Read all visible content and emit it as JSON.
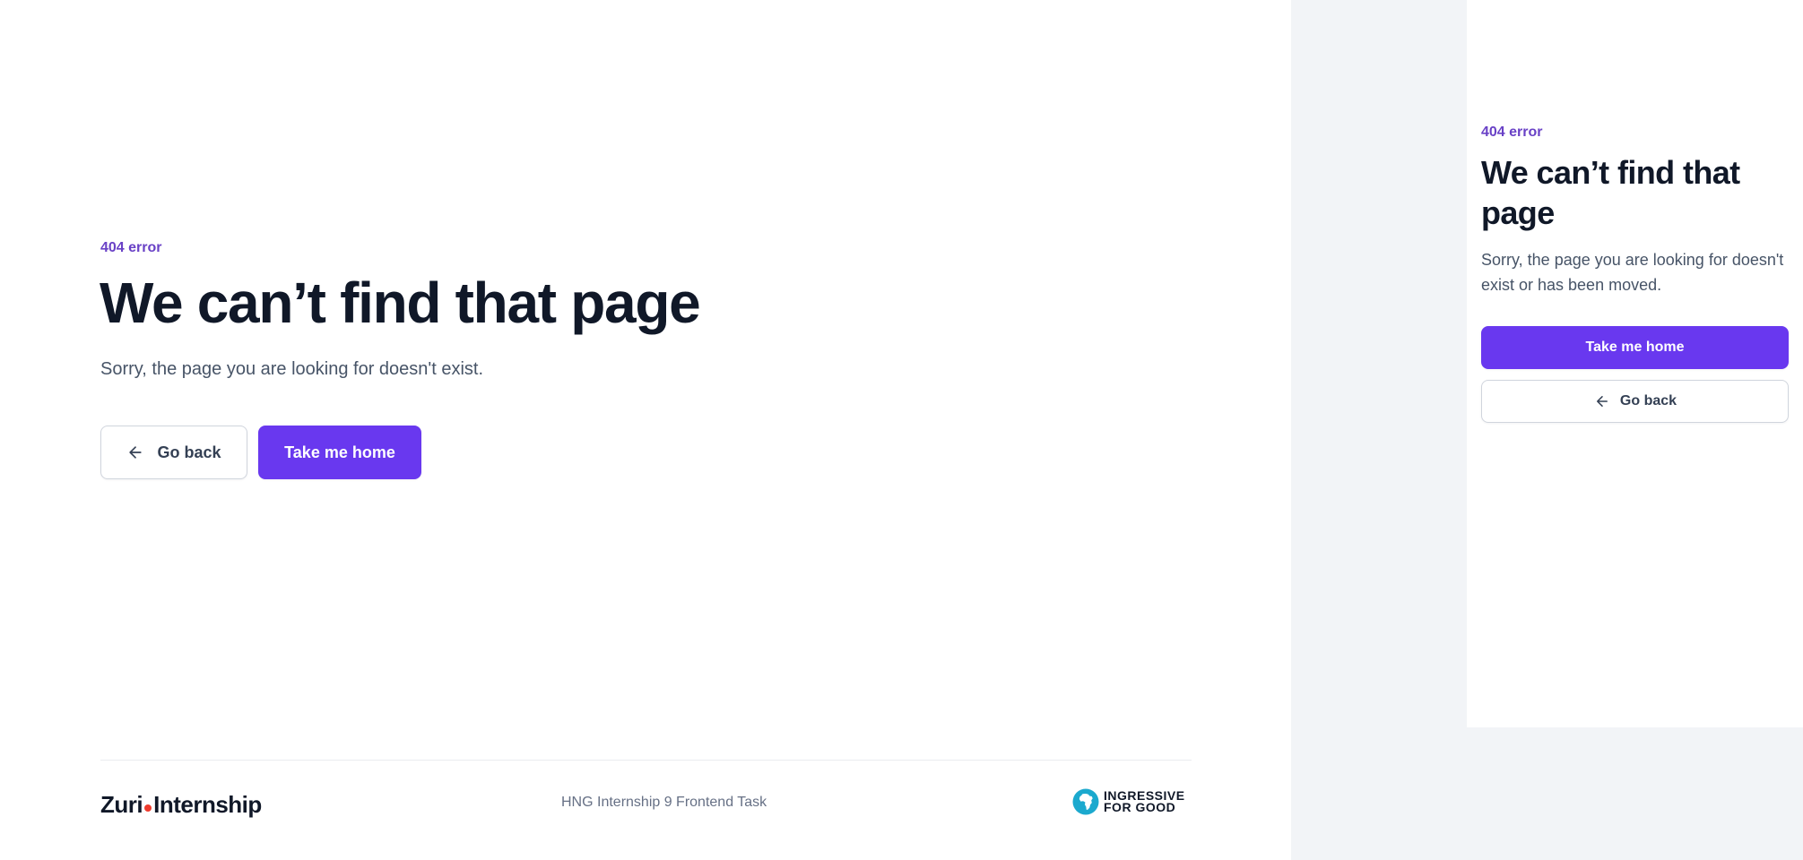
{
  "desktop": {
    "kicker": "404 error",
    "title": "We can’t find that page",
    "subtitle": "Sorry, the page you are looking for doesn't exist.",
    "back_label": "Go back",
    "home_label": "Take me home",
    "footer": {
      "logo_left_part1": "Zuri",
      "logo_left_part2": "Internship",
      "center_text": "HNG Internship 9 Frontend Task",
      "logo_right_line1": "INGRESSIVE",
      "logo_right_line2": "FOR GOOD"
    }
  },
  "mobile": {
    "kicker": "404 error",
    "title": "We can’t find that page",
    "subtitle": "Sorry, the page you are looking for doesn't exist or has been moved.",
    "home_label": "Take me home",
    "back_label": "Go back"
  },
  "icons": {
    "back": "arrow-left-icon",
    "zuri_dot": "red-dot",
    "i4g": "globe-africa-icon"
  },
  "colors": {
    "accent": "#6938EF",
    "kicker": "#6941C6",
    "heading": "#101828",
    "body": "#475467",
    "muted": "#667085",
    "side_background": "#F2F4F7",
    "zuri_dot": "#EF3B2D",
    "i4g_globe": "#1BA9CE"
  }
}
